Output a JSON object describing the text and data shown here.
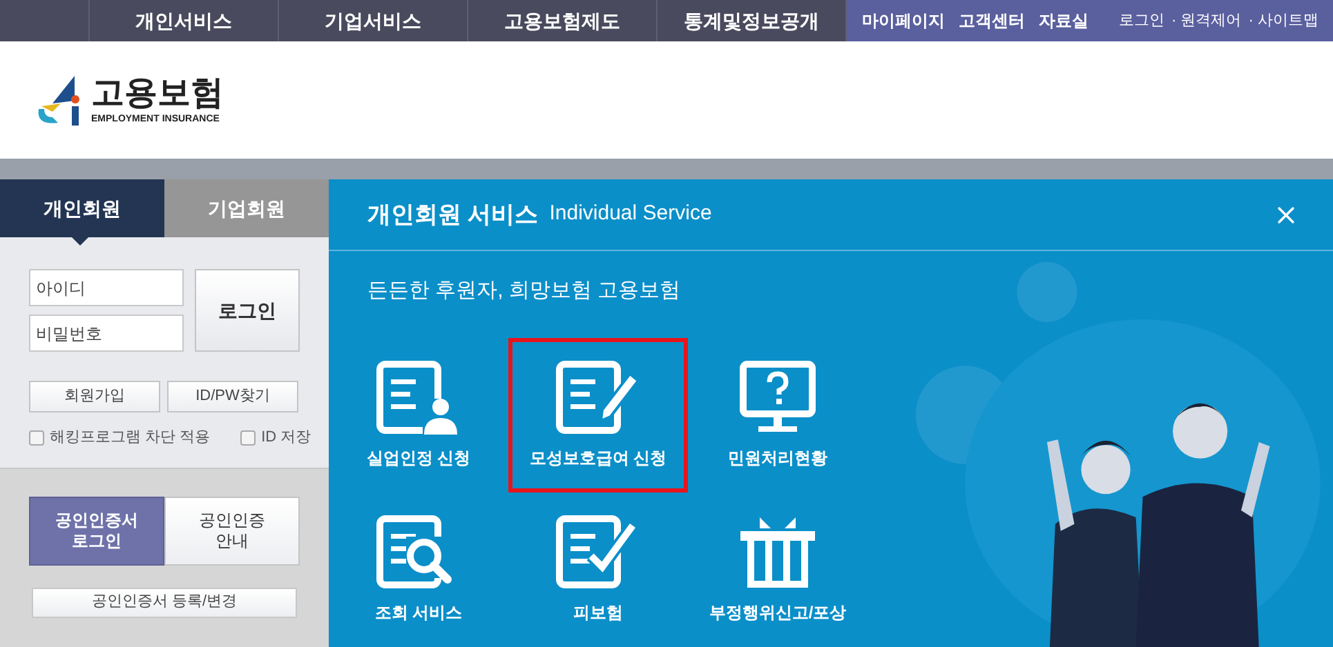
{
  "top_nav": {
    "items": [
      "개인서비스",
      "기업서비스",
      "고용보험제도",
      "통계및정보공개"
    ],
    "utility_links": [
      "마이페이지",
      "고객센터",
      "자료실"
    ],
    "account_links": [
      "로그인",
      "· 원격제어",
      "· 사이트맵"
    ]
  },
  "logo": {
    "name": "고용보험",
    "subtitle": "EMPLOYMENT INSURANCE"
  },
  "login_panel": {
    "tabs": [
      {
        "label": "개인회원",
        "selected": true
      },
      {
        "label": "기업회원",
        "selected": false
      }
    ],
    "id_field": {
      "placeholder": "아이디"
    },
    "password_field": {
      "placeholder": "비밀번호"
    },
    "login_button": "로그인",
    "buttons": [
      "회원가입",
      "ID/PW찾기"
    ],
    "checkboxes": [
      {
        "label": "해킹프로그램 차단 적용",
        "checked": false
      },
      {
        "label": "ID 저장",
        "checked": false
      }
    ],
    "cert_tabs": [
      {
        "lines": [
          "공인인증서",
          "로그인"
        ],
        "selected": true
      },
      {
        "lines": [
          "공인인증",
          "안내"
        ],
        "selected": false
      }
    ],
    "cert_register_button": "공인인증서 등록/변경"
  },
  "service_panel": {
    "title": "개인회원 서비스",
    "title_en": "Individual Service",
    "subtitle": "든든한 후원자, 희망보험 고용보험",
    "services": [
      {
        "label": "실업인정 신청",
        "kind": "document-person",
        "selected": false
      },
      {
        "label": "모성보호급여 신청",
        "kind": "document-pencil",
        "selected": true
      },
      {
        "label": "민원처리현황",
        "kind": "monitor-question",
        "selected": false
      },
      {
        "label": "조회 서비스",
        "kind": "document-search",
        "selected": false
      },
      {
        "label": "피보험",
        "kind": "document-check",
        "selected": false
      },
      {
        "label": "부정행위신고/포상",
        "kind": "gift",
        "selected": false
      }
    ]
  }
}
